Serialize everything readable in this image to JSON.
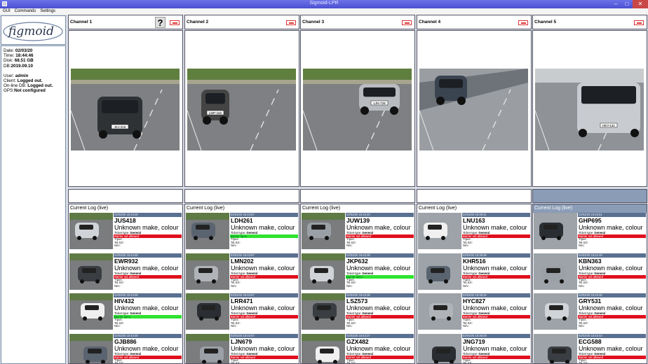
{
  "window": {
    "title": "Sigmoid-LPR",
    "min": "–",
    "max": "□",
    "close": "✕"
  },
  "menu": [
    "GUI",
    "Commands",
    "Settings"
  ],
  "logo": {
    "text": "figmoid"
  },
  "info": {
    "date_label": "Date:",
    "date": "02/03/20",
    "time_label": "Time:",
    "time": "18:44:46",
    "disk_label": "Disk:",
    "disk": "68.51 GB",
    "db_label": "DB:",
    "db": "2019.09.10",
    "user_label": "User:",
    "user": "admin",
    "client_label": "Client:",
    "client": "Logged out.",
    "online_label": "On-line DB:",
    "online": "Logged out.",
    "gps_label": "GPS:",
    "gps": "Not configured"
  },
  "log_title": "Current Log (live)",
  "help": "?",
  "entry_labels": {
    "make": "Unknown make, colour",
    "ticket_label": "Ticket type: ",
    "ticket_value": "General",
    "l1": "Típus:",
    "l2": "Tel.Szt:",
    "l3": "Név:"
  },
  "channels": [
    {
      "name": "Channel 1",
      "plate": "JKJ-315",
      "entries": [
        {
          "ts": "02/03/20 18:44:00",
          "plate": "JUS418",
          "barrier": "Barrier not allowed",
          "ok": false
        },
        {
          "ts": "02/03/20 18:44:00",
          "plate": "EWR932",
          "barrier": "Barrier not allowed",
          "ok": false
        },
        {
          "ts": "02/03/20 18:44:00",
          "plate": "HIV432",
          "barrier": "Barrier open",
          "ok": true
        },
        {
          "ts": "02/03/20 18:44:00",
          "plate": "GJB886",
          "barrier": "Barrier not allowed",
          "ok": false
        }
      ]
    },
    {
      "name": "Channel 2",
      "plate": "LMP-182",
      "entries": [
        {
          "ts": "02/03/20 18:43:57",
          "plate": "LDH261",
          "barrier": "Barrier open",
          "ok": true
        },
        {
          "ts": "02/03/20 18:43:57",
          "plate": "LMN202",
          "barrier": "Barrier not allowed",
          "ok": false
        },
        {
          "ts": "02/03/20 18:43:57",
          "plate": "LRR471",
          "barrier": "Barrier not allowed",
          "ok": false
        },
        {
          "ts": "02/03/20 18:43:57",
          "plate": "LJN679",
          "barrier": "Barrier not allowed",
          "ok": false
        }
      ]
    },
    {
      "name": "Channel 3",
      "plate": "LJN-729",
      "entries": [
        {
          "ts": "02/03/20 18:43:40",
          "plate": "JUW139",
          "barrier": "Barrier not allowed",
          "ok": false
        },
        {
          "ts": "02/03/20 18:43:39",
          "plate": "JKP632",
          "barrier": "Barrier open",
          "ok": true
        },
        {
          "ts": "02/03/20 18:43:38",
          "plate": "LSZ573",
          "barrier": "Barrier not allowed",
          "ok": false
        },
        {
          "ts": "02/03/20 18:43:37",
          "plate": "GZX482",
          "barrier": "Barrier not allowed",
          "ok": false
        }
      ]
    },
    {
      "name": "Channel 4",
      "plate": "",
      "entries": [
        {
          "ts": "02/03/20 18:38:41",
          "plate": "LNU163",
          "barrier": "Barrier not allowed",
          "ok": false
        },
        {
          "ts": "02/03/20 18:38:38",
          "plate": "KHR516",
          "barrier": "Barrier not allowed",
          "ok": false
        },
        {
          "ts": "02/03/20 18:38:34",
          "plate": "HYC827",
          "barrier": "Barrier not allowed",
          "ok": false
        },
        {
          "ts": "02/03/20 18:38:29",
          "plate": "JNG719",
          "barrier": "Barrier not allowed",
          "ok": false
        }
      ]
    },
    {
      "name": "Channel 5",
      "plate": "HEY-131",
      "entries": [
        {
          "ts": "02/03/20 18:43:51",
          "plate": "GHP695",
          "barrier": "Barrier not allowed",
          "ok": false
        },
        {
          "ts": "02/03/20 18:42:49",
          "plate": "KBN363",
          "barrier": "Barrier not allowed",
          "ok": false
        },
        {
          "ts": "02/03/20 18:43:45",
          "plate": "GRY531",
          "barrier": "Barrier not allowed",
          "ok": false
        },
        {
          "ts": "02/03/20 18:43:44",
          "plate": "ECG588",
          "barrier": "Barrier not allowed",
          "ok": false
        }
      ]
    }
  ]
}
